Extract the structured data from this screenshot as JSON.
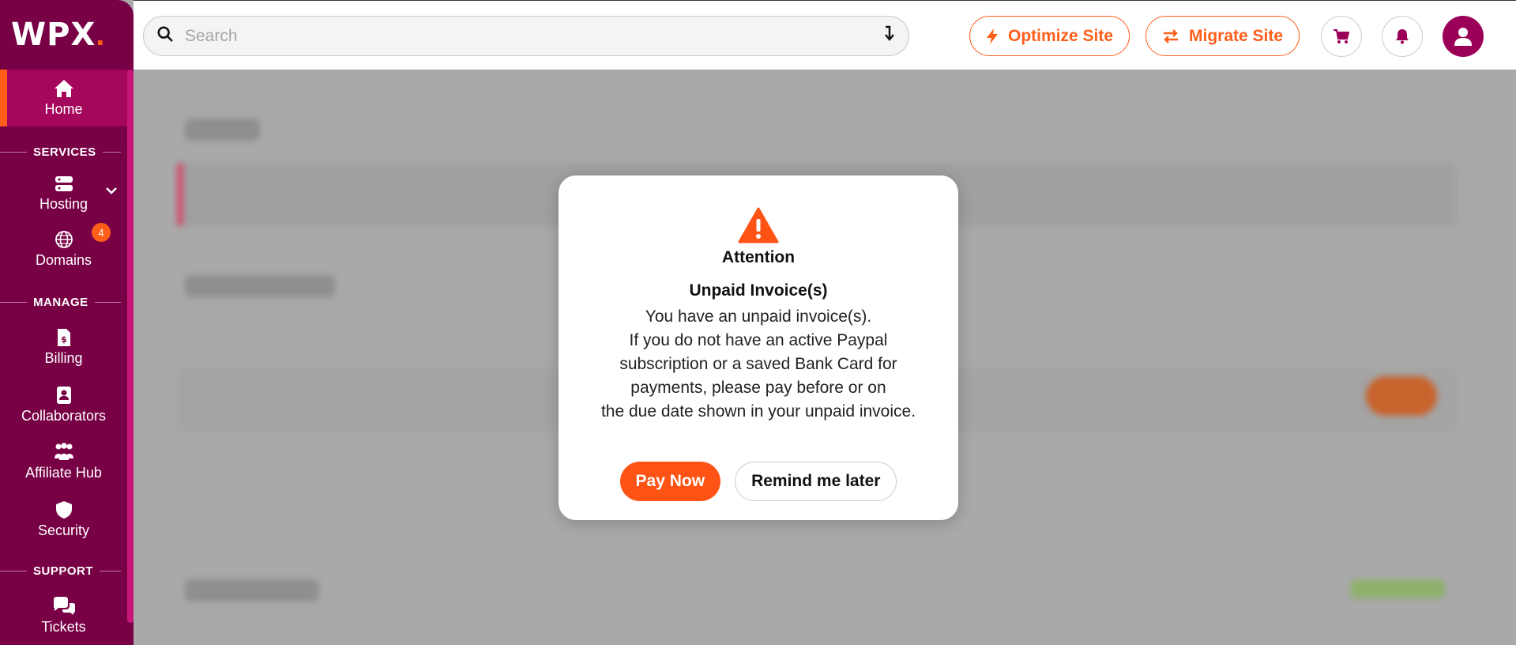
{
  "brand": {
    "logo_text": "WPX",
    "logo_dot": ".",
    "primary": "#780045",
    "accent": "#ff5e1a"
  },
  "header": {
    "search_placeholder": "Search",
    "optimize_label": "Optimize Site",
    "migrate_label": "Migrate Site"
  },
  "sidebar": {
    "home": "Home",
    "services_title": "SERVICES",
    "hosting": "Hosting",
    "domains": "Domains",
    "domains_badge": "4",
    "manage_title": "MANAGE",
    "billing": "Billing",
    "collaborators": "Collaborators",
    "affiliate": "Affiliate Hub",
    "security": "Security",
    "support_title": "SUPPORT",
    "tickets": "Tickets"
  },
  "modal": {
    "title": "Attention",
    "subtitle": "Unpaid Invoice(s)",
    "lines": [
      "You have an unpaid invoice(s).",
      "If you do not have an active Paypal",
      "subscription or a saved Bank Card for",
      "payments, please pay before or on",
      "the due date shown in your unpaid invoice."
    ],
    "pay_now": "Pay Now",
    "remind_later": "Remind me later"
  }
}
